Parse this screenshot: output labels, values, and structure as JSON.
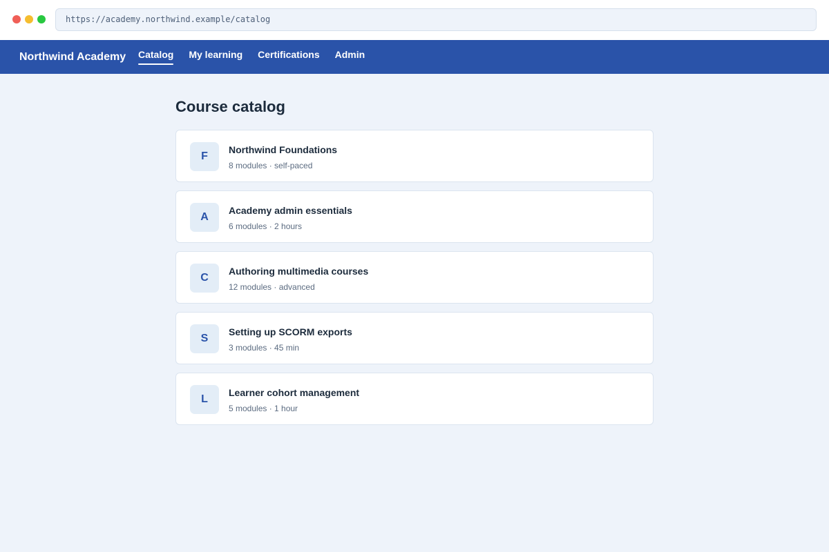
{
  "browser": {
    "url": "https://academy.northwind.example/catalog"
  },
  "nav": {
    "brand": "Northwind Academy",
    "links": [
      {
        "label": "Catalog",
        "active": true
      },
      {
        "label": "My learning",
        "active": false
      },
      {
        "label": "Certifications",
        "active": false
      },
      {
        "label": "Admin",
        "active": false
      }
    ]
  },
  "main": {
    "title": "Course catalog",
    "courses": [
      {
        "initial": "F",
        "title": "Northwind Foundations",
        "meta": "8 modules · self-paced"
      },
      {
        "initial": "A",
        "title": "Academy admin essentials",
        "meta": "6 modules · 2 hours"
      },
      {
        "initial": "C",
        "title": "Authoring multimedia courses",
        "meta": "12 modules · advanced"
      },
      {
        "initial": "S",
        "title": "Setting up SCORM exports",
        "meta": "3 modules · 45 min"
      },
      {
        "initial": "L",
        "title": "Learner cohort management",
        "meta": "5 modules · 1 hour"
      }
    ]
  },
  "colors": {
    "nav_background": "#2a53a9",
    "page_background": "#eef3fa",
    "badge_background": "#e3edf7"
  }
}
